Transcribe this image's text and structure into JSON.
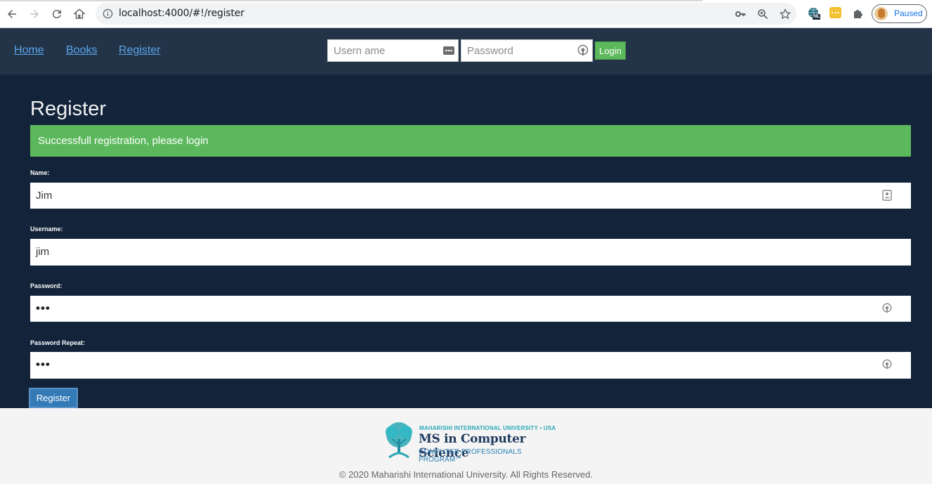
{
  "browser": {
    "url": "localhost:4000/#!/register",
    "profile_status": "Paused",
    "extension_badge": "NL"
  },
  "header": {
    "nav": [
      "Home",
      "Books",
      "Register"
    ],
    "username_placeholder": "Usern ame",
    "password_placeholder": "Password",
    "login_label": "Login"
  },
  "page": {
    "title": "Register",
    "alert": "Successfull registration, please login",
    "fields": {
      "name_label": "Name:",
      "name_value": "Jim",
      "username_label": "Username:",
      "username_value": "jim",
      "password_label": "Password:",
      "password_value": "•••",
      "password_repeat_label": "Password Repeat:",
      "password_repeat_value": "•••"
    },
    "register_button": "Register"
  },
  "footer": {
    "logo_top": "MAHARISHI INTERNATIONAL UNIVERSITY • USA",
    "logo_main": "MS in Computer Science",
    "logo_sub": "COMPUTER PROFESSIONALS PROGRAM℠",
    "copyright": "© 2020 Maharishi International University. All Rights Reserved."
  },
  "colors": {
    "header_bg": "#233448",
    "main_bg": "#12233a",
    "alert_bg": "#5cb85c",
    "button_primary": "#337ab7",
    "link": "#5aa4ea"
  }
}
